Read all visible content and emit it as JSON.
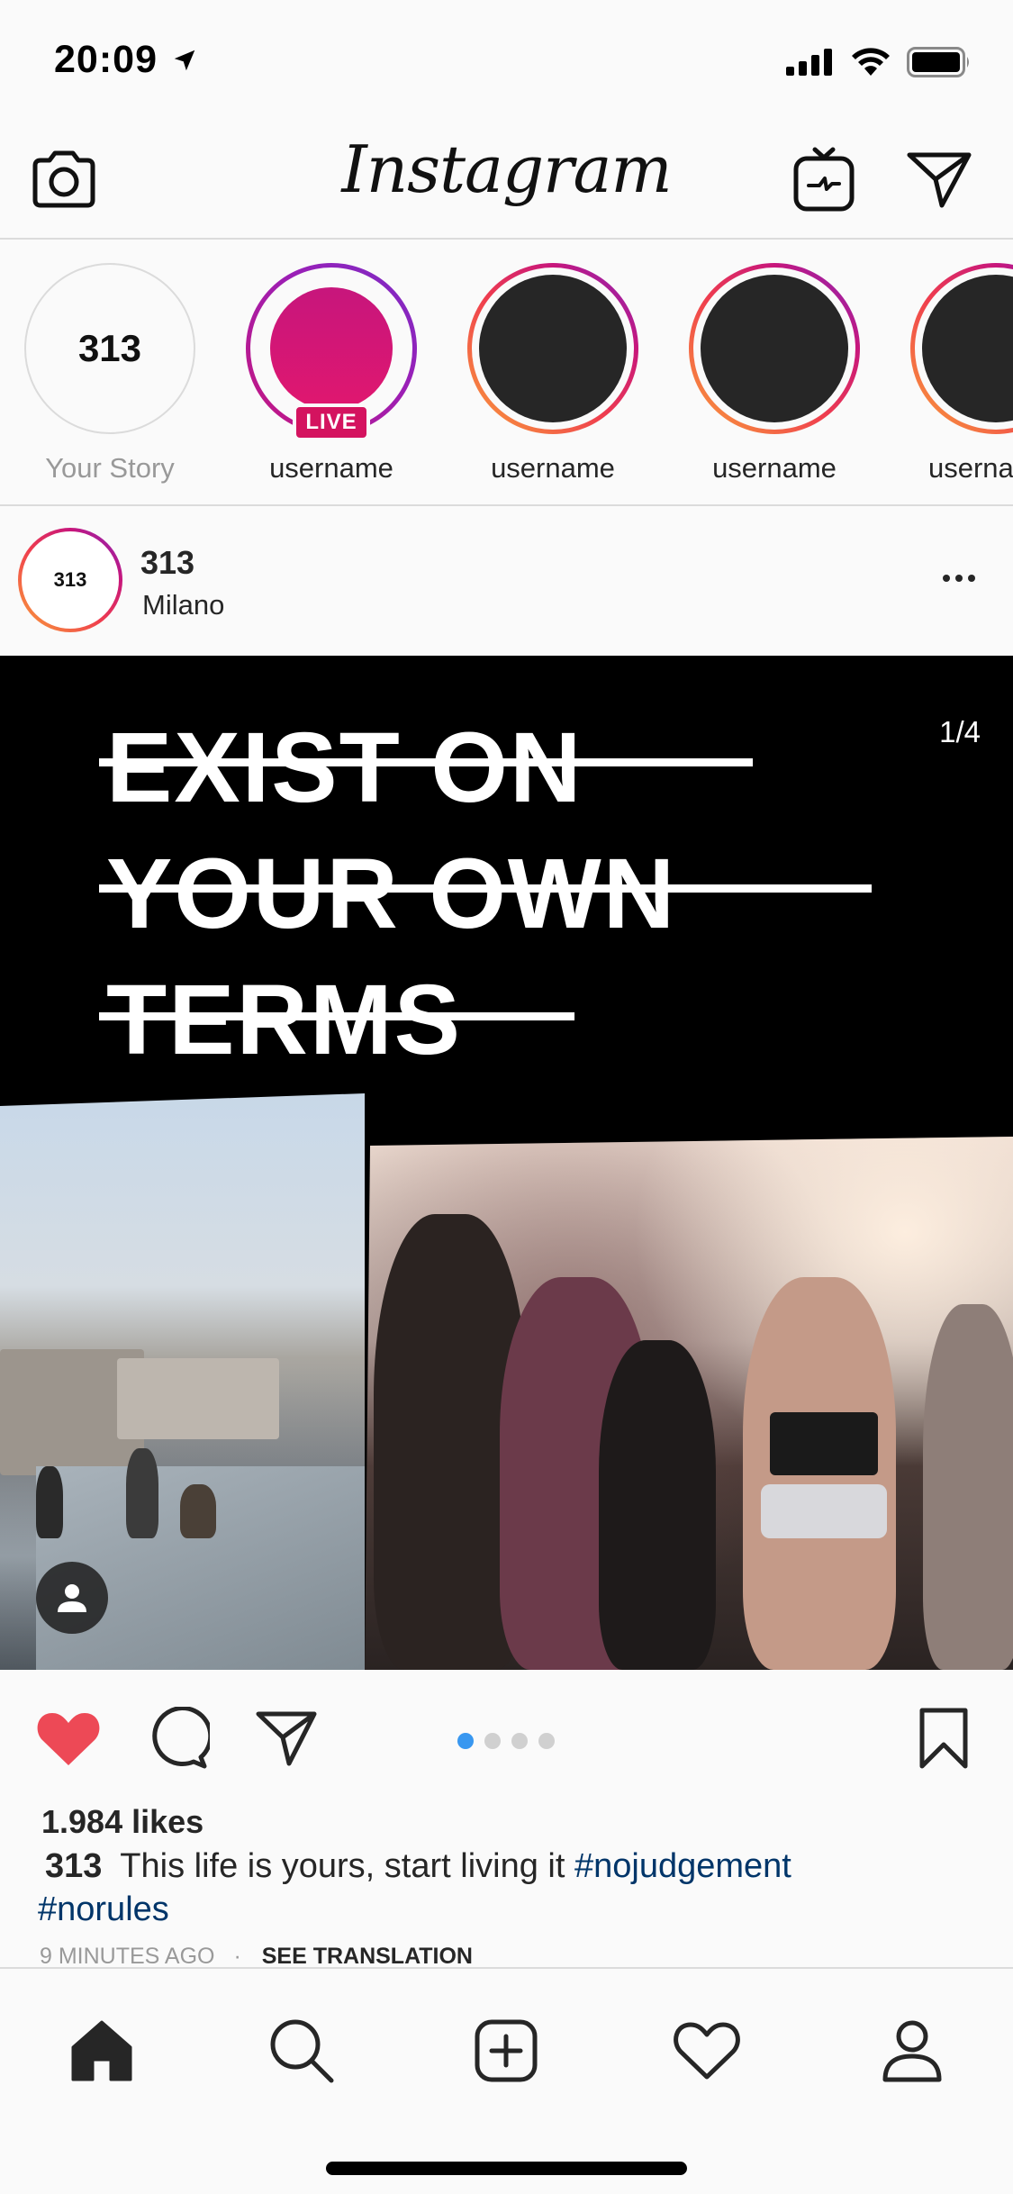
{
  "status_bar": {
    "time": "20:09"
  },
  "header": {
    "logo": "Instagram"
  },
  "stories": [
    {
      "name": "Your Story",
      "avatar_text": "313",
      "type": "own"
    },
    {
      "name": "username",
      "type": "live",
      "badge": "LIVE"
    },
    {
      "name": "username",
      "type": "normal"
    },
    {
      "name": "username",
      "type": "normal"
    },
    {
      "name": "userna",
      "type": "normal"
    }
  ],
  "post": {
    "avatar_text": "313",
    "username": "313",
    "location": "Milano",
    "headline_lines": [
      "EXIST ON",
      "YOUR OWN",
      "TERMS"
    ],
    "page_counter": "1/4",
    "carousel": {
      "count": 4,
      "active_index": 0
    },
    "liked": true,
    "likes": "1.984 likes",
    "caption": {
      "username": "313",
      "text": "This life is yours, start living it",
      "tags": [
        "#nojudgement",
        "#norules"
      ]
    },
    "time_ago": "9 MINUTES AGO",
    "separator": "·",
    "see_translation": "SEE TRANSLATION"
  },
  "colors": {
    "like_red": "#ed4956",
    "link_blue": "#003569",
    "carousel_active": "#3897f0",
    "live_badge": "#d4135f"
  },
  "tabbar": {
    "items": [
      "home-icon",
      "search-icon",
      "new-post-icon",
      "activity-heart-icon",
      "profile-icon"
    ],
    "active": "home-icon"
  }
}
